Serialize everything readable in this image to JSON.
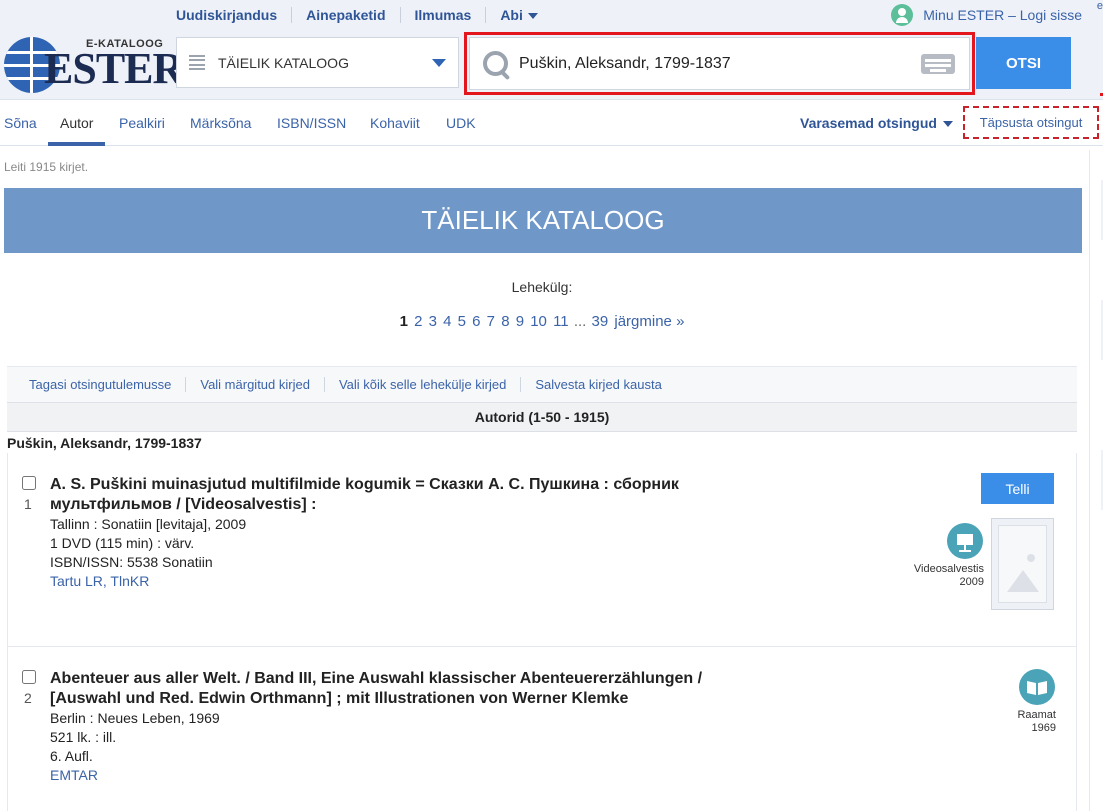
{
  "header": {
    "topnav": [
      "Uudiskirjandus",
      "Ainepaketid",
      "Ilmumas",
      "Abi"
    ],
    "user_link": "Minu ESTER – Logi sisse",
    "corner_text": "e",
    "logo": {
      "sub": "E-KATALOOG",
      "main": "ESTER"
    }
  },
  "search": {
    "catalog": "TÄIELIK KATALOOG",
    "query": "Puškin, Aleksandr, 1799-1837",
    "button": "OTSI"
  },
  "tabs": [
    "Sõna",
    "Autor",
    "Pealkiri",
    "Märksõna",
    "ISBN/ISSN",
    "Kohaviit",
    "UDK"
  ],
  "active_tab": "Autor",
  "recent_searches": "Varasemad otsingud",
  "refine": "Täpsusta otsingut",
  "results_count_text": "Leiti 1915 kirjet.",
  "banner": "TÄIELIK KATALOOG",
  "pager": {
    "label": "Lehekülg:",
    "current": "1",
    "pages": [
      "2",
      "3",
      "4",
      "5",
      "6",
      "7",
      "8",
      "9",
      "10",
      "11"
    ],
    "dots": "...",
    "last": "39",
    "next": "järgmine »"
  },
  "actions": [
    "Tagasi otsingutulemusse",
    "Vali märgitud kirjed",
    "Vali kõik selle lehekülje kirjed",
    "Salvesta kirjed kausta"
  ],
  "group_header": "Autorid (1-50 - 1915)",
  "author_heading": "Puškin, Aleksandr, 1799-1837",
  "records": [
    {
      "number": "1",
      "title": "A. S. Puškini muinasjutud multifilmide kogumik = Сказки А. С. Пушкина : сборник мультфильмов / [Videosalvestis] :",
      "lines": [
        "Tallinn : Sonatiin [levitaja], 2009",
        "1 DVD (115 min) : värv.",
        "ISBN/ISSN:  5538 Sonatiin"
      ],
      "locations": "Tartu LR, TlnKR",
      "type": "Videosalvestis",
      "year": "2009",
      "order": "Telli",
      "icon": "video-icon"
    },
    {
      "number": "2",
      "title": "Abenteuer aus aller Welt. / Band III, Eine Auswahl klassischer Abenteuererzählungen / [Auswahl und Red. Edwin Orthmann] ; mit Illustrationen von Werner Klemke",
      "lines": [
        "Berlin : Neues Leben, 1969",
        "521 lk. : ill.",
        "6. Aufl."
      ],
      "locations": "EMTAR",
      "type": "Raamat",
      "year": "1969",
      "icon": "book-icon"
    }
  ],
  "colors": {
    "accent": "#3b8ee8",
    "banner": "#6f98c9",
    "link": "#3b63a8",
    "highlight": "#e3161e",
    "type_icon": "#4aa3b7"
  }
}
